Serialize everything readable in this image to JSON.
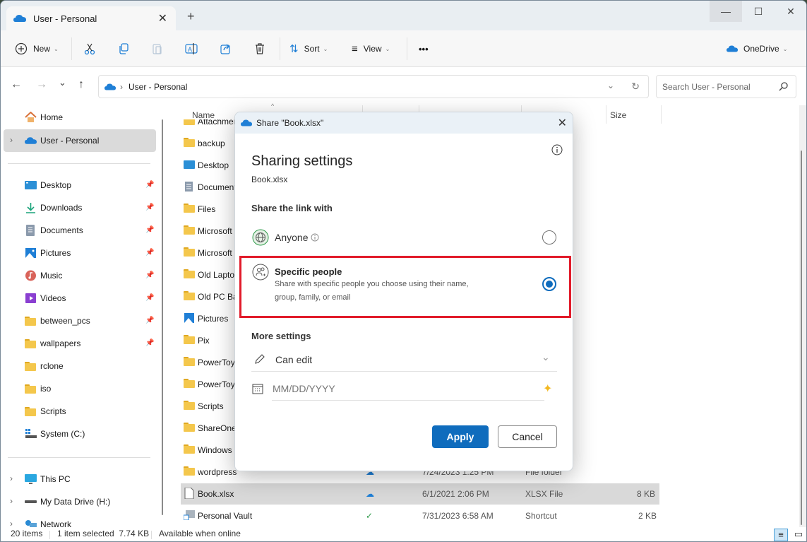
{
  "window": {
    "tab_title": "User - Personal",
    "new_tab": "+",
    "controls": {
      "minimize": "—",
      "maximize": "☐",
      "close": "✕"
    }
  },
  "toolbar": {
    "new_label": "New",
    "sort_label": "Sort",
    "view_label": "View",
    "more_label": "•••",
    "onedrive_label": "OneDrive"
  },
  "nav": {
    "back": "←",
    "forward": "→",
    "recent": "⌄",
    "up": "↑",
    "address_path": "User - Personal",
    "search_placeholder": "Search User - Personal"
  },
  "sidebar": {
    "top": [
      {
        "label": "Home",
        "icon": "home-icon"
      },
      {
        "label": "User - Personal",
        "icon": "onedrive-cloud-icon",
        "selected": true
      }
    ],
    "quick_access": [
      {
        "label": "Desktop",
        "icon": "desktop-icon",
        "pinned": true
      },
      {
        "label": "Downloads",
        "icon": "downloads-icon",
        "pinned": true
      },
      {
        "label": "Documents",
        "icon": "documents-icon",
        "pinned": true
      },
      {
        "label": "Pictures",
        "icon": "pictures-icon",
        "pinned": true
      },
      {
        "label": "Music",
        "icon": "music-icon",
        "pinned": true
      },
      {
        "label": "Videos",
        "icon": "videos-icon",
        "pinned": true
      },
      {
        "label": "between_pcs",
        "icon": "folder-icon",
        "pinned": true
      },
      {
        "label": "wallpapers",
        "icon": "folder-icon",
        "pinned": true
      },
      {
        "label": "rclone",
        "icon": "folder-icon",
        "pinned": false
      },
      {
        "label": "iso",
        "icon": "folder-icon",
        "pinned": false
      },
      {
        "label": "Scripts",
        "icon": "folder-icon",
        "pinned": false
      },
      {
        "label": "System (C:)",
        "icon": "drive-c-icon",
        "pinned": false
      }
    ],
    "bottom": [
      {
        "label": "This PC",
        "icon": "this-pc-icon"
      },
      {
        "label": "My Data Drive (H:)",
        "icon": "drive-icon"
      },
      {
        "label": "Network",
        "icon": "network-icon"
      }
    ]
  },
  "file_list": {
    "columns": {
      "name": "Name",
      "size": "Size"
    },
    "rows": [
      {
        "name": "Attachments",
        "icon": "folder"
      },
      {
        "name": "backup",
        "icon": "folder"
      },
      {
        "name": "Desktop",
        "icon": "desktop"
      },
      {
        "name": "Documents",
        "icon": "documents"
      },
      {
        "name": "Files",
        "icon": "folder"
      },
      {
        "name": "Microsoft",
        "icon": "folder"
      },
      {
        "name": "Microsoft",
        "icon": "folder"
      },
      {
        "name": "Old Laptop",
        "icon": "folder"
      },
      {
        "name": "Old PC Backup",
        "icon": "folder"
      },
      {
        "name": "Pictures",
        "icon": "pictures"
      },
      {
        "name": "Pix",
        "icon": "folder"
      },
      {
        "name": "PowerToys",
        "icon": "folder"
      },
      {
        "name": "PowerToys",
        "icon": "folder"
      },
      {
        "name": "Scripts",
        "icon": "folder"
      },
      {
        "name": "ShareOne",
        "icon": "folder"
      },
      {
        "name": "Windows",
        "icon": "folder"
      },
      {
        "name": "wordpress",
        "icon": "folder",
        "date": "7/24/2023 1:25 PM",
        "type": "File folder",
        "size": "",
        "status": "cloud"
      },
      {
        "name": "Book.xlsx",
        "icon": "file",
        "date": "6/1/2021 2:06 PM",
        "type": "XLSX File",
        "size": "8 KB",
        "status": "cloud",
        "selected": true
      },
      {
        "name": "Personal Vault",
        "icon": "shortcut",
        "date": "7/31/2023 6:58 AM",
        "type": "Shortcut",
        "size": "2 KB",
        "status": "synced"
      }
    ]
  },
  "status_bar": {
    "items_count": "20 items",
    "selection": "1 item selected  7.74 KB",
    "availability": "Available when online"
  },
  "dialog": {
    "title": "Share \"Book.xlsx\"",
    "heading": "Sharing settings",
    "filename": "Book.xlsx",
    "share_with_label": "Share the link with",
    "options": [
      {
        "label": "Anyone",
        "description": "",
        "selected": false
      },
      {
        "label": "Specific people",
        "description_line1": "Share with specific people you choose using their name,",
        "description_line2": "group, family, or email",
        "selected": true
      }
    ],
    "more_settings_label": "More settings",
    "permission_value": "Can edit",
    "expiry_placeholder": "MM/DD/YYYY",
    "apply_label": "Apply",
    "cancel_label": "Cancel"
  },
  "colors": {
    "accent": "#0f6cbd",
    "highlight_border": "#e11b2a",
    "onedrive_blue": "#1f7fd6",
    "folder_yellow": "#f4c74c",
    "sync_green": "#2e9a4a",
    "premium_star": "#f3b81f"
  }
}
